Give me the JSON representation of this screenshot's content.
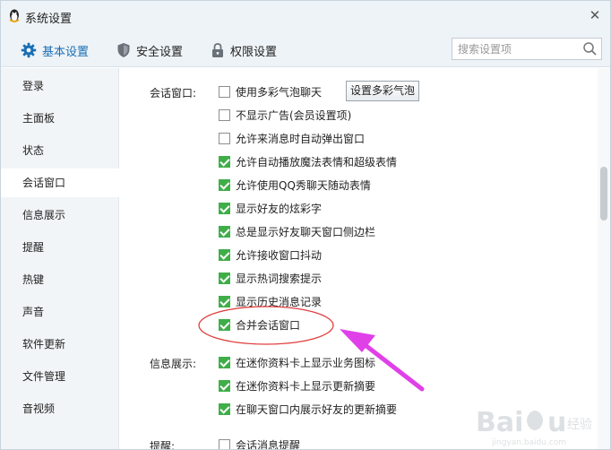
{
  "window": {
    "title": "系统设置"
  },
  "tabs": [
    {
      "label": "基本设置",
      "active": true,
      "icon": "gear-icon"
    },
    {
      "label": "安全设置",
      "active": false,
      "icon": "shield-icon"
    },
    {
      "label": "权限设置",
      "active": false,
      "icon": "lock-icon"
    }
  ],
  "search": {
    "placeholder": "搜索设置项"
  },
  "sidebar": {
    "items": [
      {
        "label": "登录"
      },
      {
        "label": "主面板"
      },
      {
        "label": "状态"
      },
      {
        "label": "会话窗口",
        "active": true
      },
      {
        "label": "信息展示"
      },
      {
        "label": "提醒"
      },
      {
        "label": "热键"
      },
      {
        "label": "声音"
      },
      {
        "label": "软件更新"
      },
      {
        "label": "文件管理"
      },
      {
        "label": "音视频"
      }
    ]
  },
  "sections": {
    "session": {
      "label": "会话窗口:",
      "bubble_button": "设置多彩气泡",
      "options": [
        {
          "label": "使用多彩气泡聊天",
          "checked": false
        },
        {
          "label": "不显示广告(会员设置项)",
          "checked": false
        },
        {
          "label": "允许来消息时自动弹出窗口",
          "checked": false
        },
        {
          "label": "允许自动播放魔法表情和超级表情",
          "checked": true
        },
        {
          "label": "允许使用QQ秀聊天随动表情",
          "checked": true
        },
        {
          "label": "显示好友的炫彩字",
          "checked": true
        },
        {
          "label": "总是显示好友聊天窗口侧边栏",
          "checked": true
        },
        {
          "label": "允许接收窗口抖动",
          "checked": true
        },
        {
          "label": "显示热词搜索提示",
          "checked": true
        },
        {
          "label": "显示历史消息记录",
          "checked": true
        },
        {
          "label": "合并会话窗口",
          "checked": true
        }
      ]
    },
    "info": {
      "label": "信息展示:",
      "options": [
        {
          "label": "在迷你资料卡上显示业务图标",
          "checked": true
        },
        {
          "label": "在迷你资料卡上显示更新摘要",
          "checked": true
        },
        {
          "label": "在聊天窗口内展示好友的更新摘要",
          "checked": true
        }
      ]
    },
    "remind": {
      "label": "提醒:",
      "options": [
        {
          "label": "会话消息提醒",
          "checked": false
        }
      ]
    }
  },
  "colors": {
    "accent": "#1a6fb5",
    "check": "#3fae49",
    "annotation": "#e040e8",
    "circle": "#e03c3c"
  }
}
